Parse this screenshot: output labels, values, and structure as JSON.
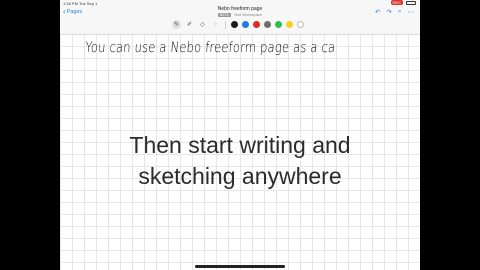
{
  "status": {
    "time": "1:18 PM",
    "date": "Tue Sep 1",
    "record": "REC"
  },
  "nav": {
    "back_label": "Pages"
  },
  "document": {
    "title": "Nebo freeform page",
    "tag": "BETA",
    "subtitle": "Test Workspace"
  },
  "toolbar": {
    "tools": [
      {
        "name": "pen",
        "glyph": "✎",
        "selected": true
      },
      {
        "name": "highlighter",
        "glyph": "✐",
        "selected": false
      },
      {
        "name": "eraser",
        "glyph": "◇",
        "selected": false
      },
      {
        "name": "lasso",
        "glyph": "◌",
        "selected": false
      }
    ],
    "colors": [
      "#1a1a1a",
      "#1e7be0",
      "#e02a2a",
      "#6d6d6d",
      "#2dbf4a",
      "#f2d21b",
      "#ffffff"
    ]
  },
  "right_icons": {
    "undo": "↶",
    "redo": "↷",
    "search": "⌕",
    "more": "⋯"
  },
  "canvas": {
    "handwriting": "You can use a Nebo freeform page as a ca",
    "caption_line1": "Then start writing and",
    "caption_line2": "sketching anywhere"
  }
}
